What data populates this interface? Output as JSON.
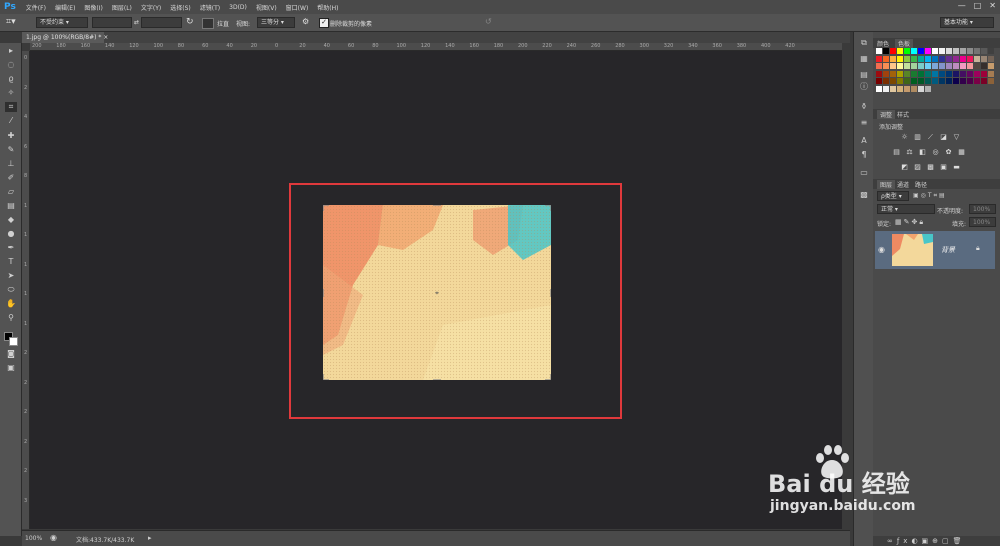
{
  "app": {
    "logo": "Ps",
    "menu": [
      "文件(F)",
      "编辑(E)",
      "图像(I)",
      "图层(L)",
      "文字(Y)",
      "选择(S)",
      "滤镜(T)",
      "3D(D)",
      "视图(V)",
      "窗口(W)",
      "帮助(H)"
    ],
    "window_controls": [
      "—",
      "□",
      "✕"
    ]
  },
  "options_bar": {
    "ratio_select": "不受约束",
    "swap_symbol": "⇄",
    "straighten_label": "拉直",
    "view_label": "视图:",
    "view_select": "三等分",
    "delete_cropped_label": "删除裁剪的像素",
    "delete_cropped_checked": true,
    "workspace_select": "基本功能"
  },
  "document": {
    "tab_label": "1.jpg @ 100%(RGB/8#) *"
  },
  "rulers": {
    "horizontal": [
      "200",
      "180",
      "160",
      "140",
      "120",
      "100",
      "80",
      "60",
      "40",
      "20",
      "0",
      "20",
      "40",
      "60",
      "80",
      "100",
      "120",
      "140",
      "160",
      "180",
      "200",
      "220",
      "240",
      "260",
      "280",
      "300",
      "320",
      "340",
      "360",
      "380",
      "400",
      "420"
    ],
    "vertical": [
      "0",
      "2",
      "4",
      "6",
      "8",
      "1",
      "1",
      "1",
      "1",
      "1",
      "2",
      "2",
      "2",
      "2",
      "2",
      "3"
    ]
  },
  "status": {
    "zoom": "100%",
    "doc_info": "文档:433.7K/433.7K"
  },
  "color_panel": {
    "tabs": [
      "颜色",
      "色板"
    ],
    "active_tab": 1
  },
  "adjustments_panel": {
    "tabs": [
      "调整",
      "样式"
    ],
    "title": "添加调整"
  },
  "layers_panel": {
    "tabs": [
      "图层",
      "通道",
      "路径"
    ],
    "kind_select": "ρ类型",
    "blend_mode": "正常",
    "opacity_label": "不透明度:",
    "opacity_value": "100%",
    "lock_label": "锁定:",
    "fill_label": "填充:",
    "fill_value": "100%",
    "layer_name": "背景"
  },
  "watermark": {
    "brand": "Bai du 经验",
    "url": "jingyan.baidu.com"
  },
  "colors": {
    "red_box": "#e0393c",
    "canvas_bg": "#272629",
    "selected_layer": "#5a6b80"
  }
}
